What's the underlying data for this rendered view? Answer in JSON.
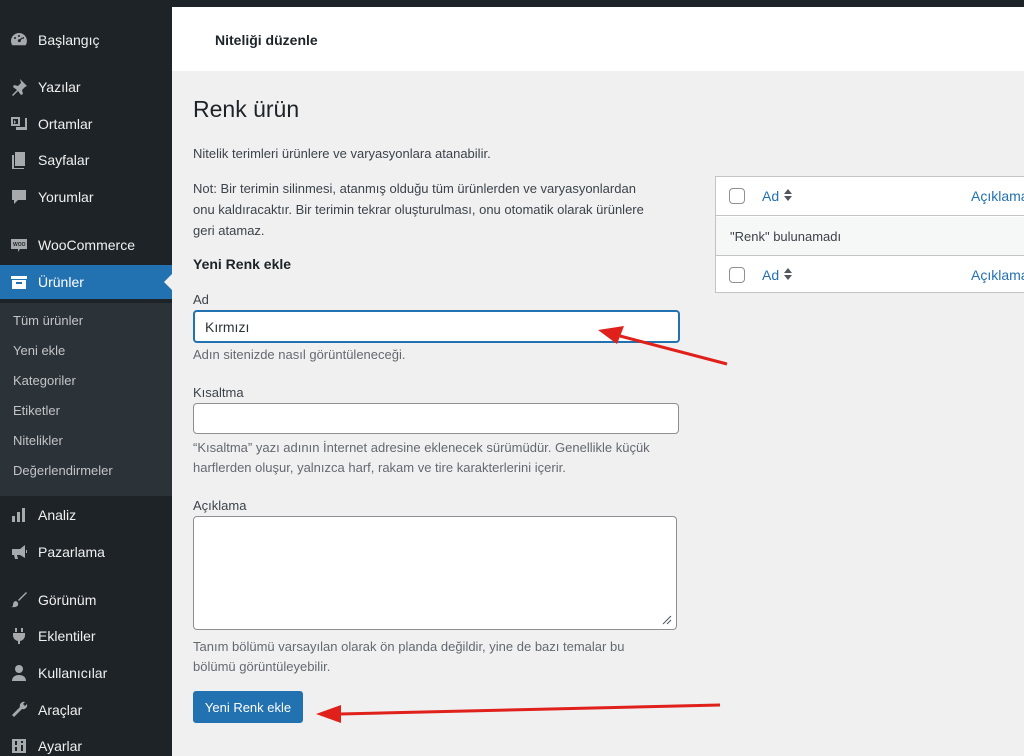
{
  "sidebar": {
    "items": [
      {
        "label": "Başlangıç",
        "icon": "dashboard-icon"
      },
      {
        "label": "Yazılar",
        "icon": "pin-icon"
      },
      {
        "label": "Ortamlar",
        "icon": "media-icon"
      },
      {
        "label": "Sayfalar",
        "icon": "pages-icon"
      },
      {
        "label": "Yorumlar",
        "icon": "comments-icon"
      },
      {
        "label": "WooCommerce",
        "icon": "woocommerce-icon"
      },
      {
        "label": "Ürünler",
        "icon": "products-icon"
      },
      {
        "label": "Analiz",
        "icon": "analytics-icon"
      },
      {
        "label": "Pazarlama",
        "icon": "megaphone-icon"
      },
      {
        "label": "Görünüm",
        "icon": "brush-icon"
      },
      {
        "label": "Eklentiler",
        "icon": "plugin-icon"
      },
      {
        "label": "Kullanıcılar",
        "icon": "users-icon"
      },
      {
        "label": "Araçlar",
        "icon": "wrench-icon"
      },
      {
        "label": "Ayarlar",
        "icon": "settings-icon"
      }
    ],
    "submenu": [
      "Tüm ürünler",
      "Yeni ekle",
      "Kategoriler",
      "Etiketler",
      "Nitelikler",
      "Değerlendirmeler"
    ]
  },
  "header": {
    "title": "Niteliği düzenle"
  },
  "page": {
    "title": "Renk ürün",
    "intro": "Nitelik terimleri ürünlere ve varyasyonlara atanabilir.",
    "note_line1": "Not: Bir terimin silinmesi, atanmış olduğu tüm ürünlerden ve varyasyonlardan",
    "note_line2": "onu kaldıracaktır. Bir terimin tekrar oluşturulması, onu otomatik olarak ürünlere",
    "note_line3": "geri atamaz."
  },
  "form": {
    "heading": "Yeni Renk ekle",
    "name_label": "Ad",
    "name_value": "Kırmızı",
    "name_hint": "Adın sitenizde nasıl görüntüleneceği.",
    "slug_label": "Kısaltma",
    "slug_value": "",
    "slug_hint_line1": "“Kısaltma” yazı adının İnternet adresine eklenecek sürümüdür. Genellikle küçük",
    "slug_hint_line2": "harflerden oluşur, yalnızca harf, rakam ve tire karakterlerini içerir.",
    "desc_label": "Açıklama",
    "desc_value": "",
    "desc_hint_line1": "Tanım bölümü varsayılan olarak ön planda değildir, yine de bazı temalar bu",
    "desc_hint_line2": "bölümü görüntüleyebilir.",
    "submit_label": "Yeni Renk ekle"
  },
  "table": {
    "col_name": "Ad",
    "col_desc": "Açıklama",
    "empty_message": "\"Renk\" bulunamadı"
  },
  "colors": {
    "accent": "#2271b1",
    "sidebar": "#1d2327",
    "arrow": "#e0201b"
  }
}
